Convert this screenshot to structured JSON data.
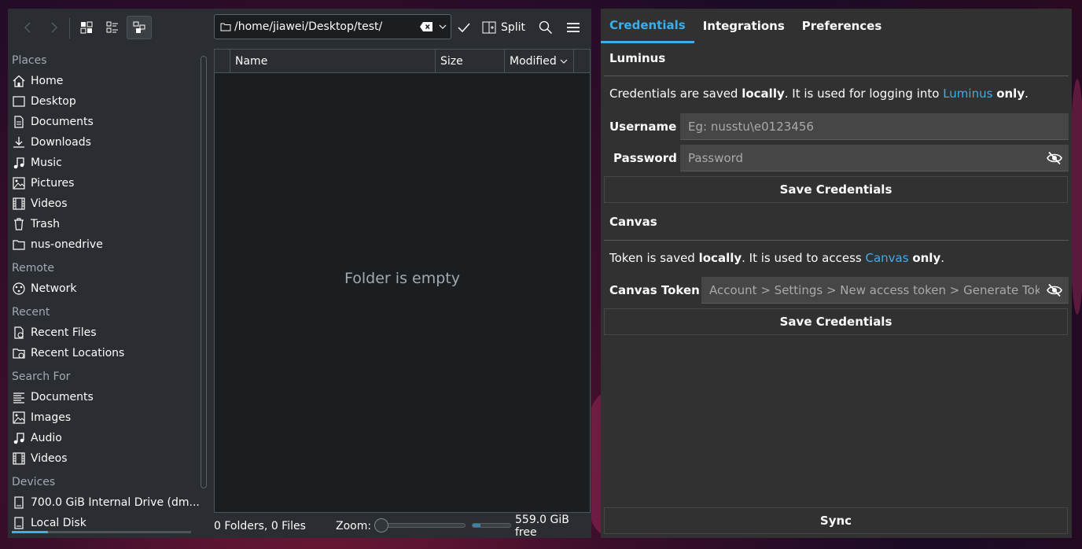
{
  "colors": {
    "accent": "#3daee9",
    "panel_bg": "#313131",
    "dolphin_bg": "#2a2e32",
    "view_bg": "#1b1e20"
  },
  "dolphin": {
    "toolbar": {
      "back_icon": "chevron-left-icon",
      "forward_icon": "chevron-right-icon",
      "icons_view_icon": "icons-view-icon",
      "compact_view_icon": "compact-view-icon",
      "details_view_icon": "details-view-icon",
      "path": "/home/jiawei/Desktop/test/",
      "split_label": "Split"
    },
    "places": {
      "sections": [
        {
          "title": "Places",
          "items": [
            {
              "label": "Home",
              "icon": "home-icon"
            },
            {
              "label": "Desktop",
              "icon": "desktop-icon"
            },
            {
              "label": "Documents",
              "icon": "documents-icon"
            },
            {
              "label": "Downloads",
              "icon": "downloads-icon"
            },
            {
              "label": "Music",
              "icon": "music-icon"
            },
            {
              "label": "Pictures",
              "icon": "pictures-icon"
            },
            {
              "label": "Videos",
              "icon": "videos-icon"
            },
            {
              "label": "Trash",
              "icon": "trash-icon"
            },
            {
              "label": "nus-onedrive",
              "icon": "folder-icon"
            }
          ]
        },
        {
          "title": "Remote",
          "items": [
            {
              "label": "Network",
              "icon": "network-icon"
            }
          ]
        },
        {
          "title": "Recent",
          "items": [
            {
              "label": "Recent Files",
              "icon": "recent-files-icon"
            },
            {
              "label": "Recent Locations",
              "icon": "recent-locations-icon"
            }
          ]
        },
        {
          "title": "Search For",
          "items": [
            {
              "label": "Documents",
              "icon": "documents-search-icon"
            },
            {
              "label": "Images",
              "icon": "images-icon"
            },
            {
              "label": "Audio",
              "icon": "audio-icon"
            },
            {
              "label": "Videos",
              "icon": "videos-icon"
            }
          ]
        },
        {
          "title": "Devices",
          "items": [
            {
              "label": "700.0 GiB Internal Drive (dm...",
              "icon": "drive-icon",
              "usage_fraction": 0.2
            },
            {
              "label": "Local Disk",
              "icon": "drive-icon"
            }
          ]
        }
      ]
    },
    "view": {
      "columns": [
        "Name",
        "Size",
        "Modified"
      ],
      "empty_message": "Folder is empty"
    },
    "status": {
      "counts": "0 Folders, 0 Files",
      "zoom_label": "Zoom:",
      "zoom_fraction": 0.0,
      "free_space": "559.0 GiB free",
      "used_fraction": 0.2
    }
  },
  "app": {
    "tabs": [
      "Credentials",
      "Integrations",
      "Preferences"
    ],
    "active_tab": "Credentials",
    "luminus": {
      "title": "Luminus",
      "note_pre": "Credentials are saved ",
      "note_bold1": "locally",
      "note_mid": ". It is used for logging into ",
      "note_link": "Luminus",
      "note_bold2": "only",
      "note_end": ".",
      "username_label": "Username",
      "username_placeholder": "Eg: nusstu\\e0123456",
      "password_label": "Password",
      "password_placeholder": "Password",
      "save_label": "Save Credentials"
    },
    "canvas": {
      "title": "Canvas",
      "note_pre": "Token is saved ",
      "note_bold1": "locally",
      "note_mid": ". It is used to access ",
      "note_link": "Canvas",
      "note_bold2": "only",
      "note_end": ".",
      "token_label": "Canvas Token",
      "token_placeholder": "Account > Settings > New access token > Generate Token",
      "save_label": "Save Credentials"
    },
    "sync_label": "Sync"
  }
}
